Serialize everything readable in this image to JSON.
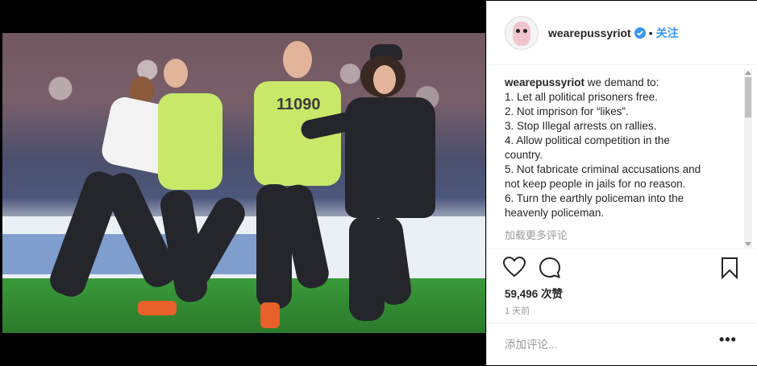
{
  "post": {
    "username": "wearepussyriot",
    "follow_label": "关注",
    "separator": "•",
    "caption_user": "wearepussyriot",
    "caption_lines": [
      " we demand to:",
      "1. Let all political prisoners free.",
      "2. Not imprison for “likes”.",
      "3. Stop Illegal arrests on rallies.",
      "4. Allow political competition in the",
      "country.",
      "5. Not fabricate criminal accusations and",
      "not keep people in jails for no reason.",
      "6. Turn the earthly policeman into the",
      "heavenly policeman."
    ],
    "load_more": "加载更多评论",
    "likes": "59,496 次赞",
    "time": "1 天前",
    "comment_placeholder": "添加评论...",
    "more": "•••"
  },
  "photo": {
    "steward_number": "11090"
  },
  "icons": {
    "verified": "verified-badge-icon",
    "like": "heart-icon",
    "comment": "comment-icon",
    "save": "bookmark-icon",
    "more": "more-options-icon"
  },
  "colors": {
    "link_blue": "#3897f0",
    "text": "#262626",
    "muted": "#999999"
  }
}
